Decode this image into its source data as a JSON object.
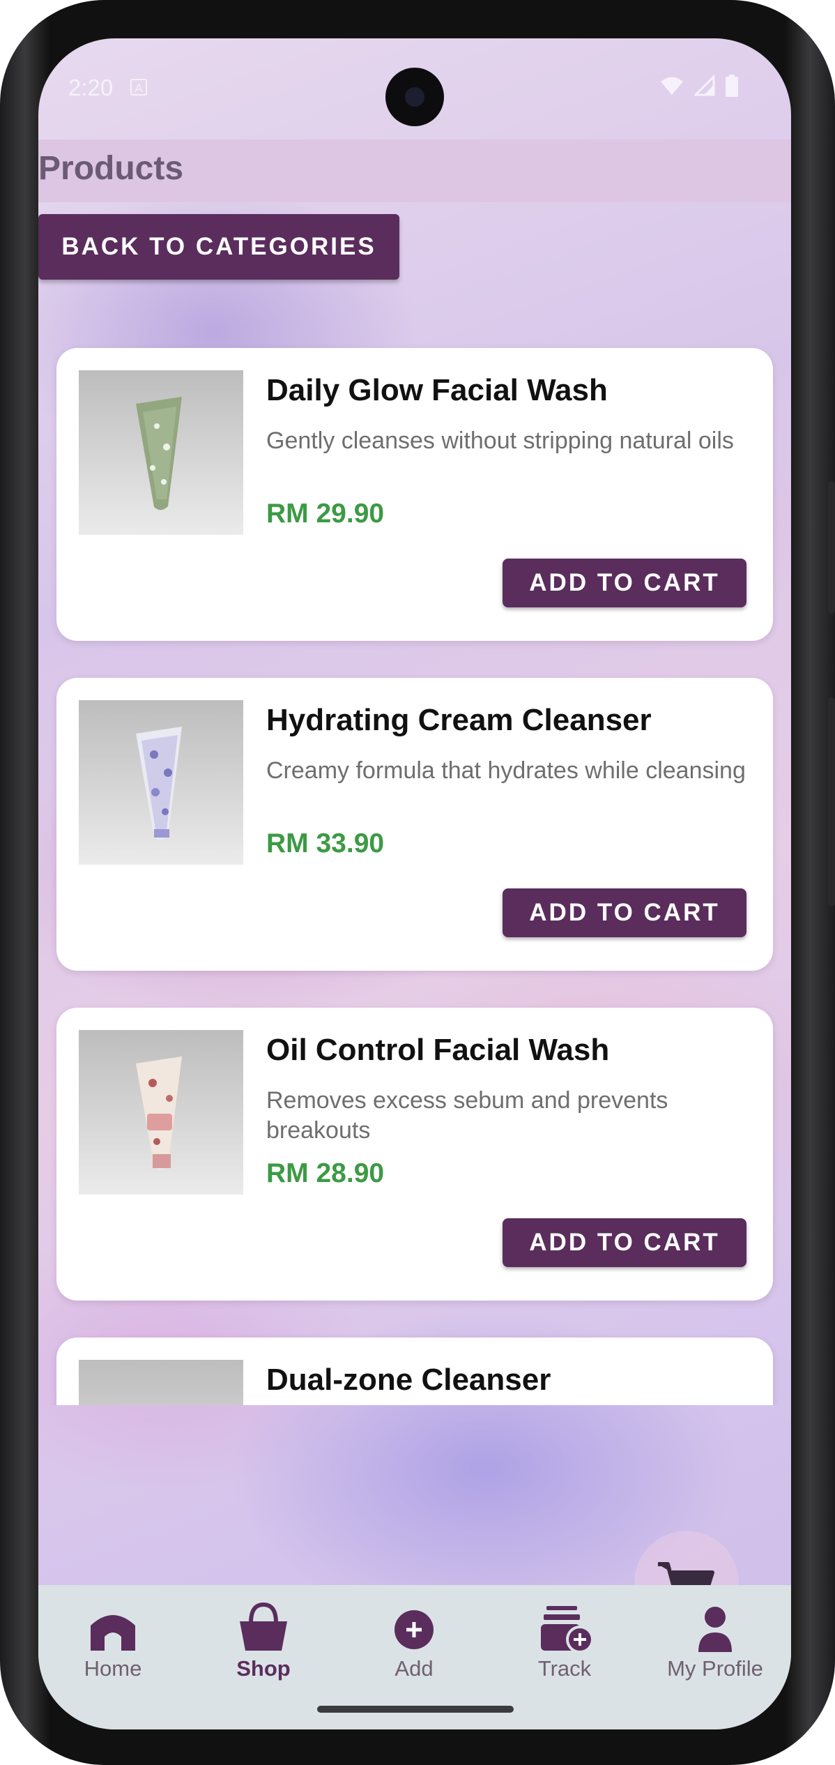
{
  "status_bar": {
    "time": "2:20"
  },
  "app_bar": {
    "title": "Products"
  },
  "back_button": {
    "label": "BACK TO CATEGORIES"
  },
  "colors": {
    "primary": "#5a2d5d",
    "price": "#3c9a44",
    "app_bar": "#dcc6e3",
    "nav_background": "#dbe2e6"
  },
  "products": [
    {
      "name": "Daily Glow Facial Wash",
      "description": "Gently cleanses without stripping natural oils",
      "price": "RM 29.90",
      "button": "ADD TO CART"
    },
    {
      "name": "Hydrating Cream Cleanser",
      "description": "Creamy formula that hydrates while cleansing",
      "price": "RM 33.90",
      "button": "ADD TO CART"
    },
    {
      "name": "Oil Control Facial Wash",
      "description": "Removes excess sebum and prevents breakouts",
      "price": "RM 28.90",
      "button": "ADD TO CART"
    },
    {
      "name": "Dual-zone Cleanser"
    }
  ],
  "fab": {
    "icon": "cart-icon"
  },
  "bottom_nav": {
    "items": [
      {
        "label": "Home",
        "icon": "home-icon"
      },
      {
        "label": "Shop",
        "icon": "shopping-bag-icon",
        "active": true
      },
      {
        "label": "Add",
        "icon": "add-circle-icon"
      },
      {
        "label": "Track",
        "icon": "track-orders-icon"
      },
      {
        "label": "My Profile",
        "icon": "person-icon"
      }
    ]
  }
}
